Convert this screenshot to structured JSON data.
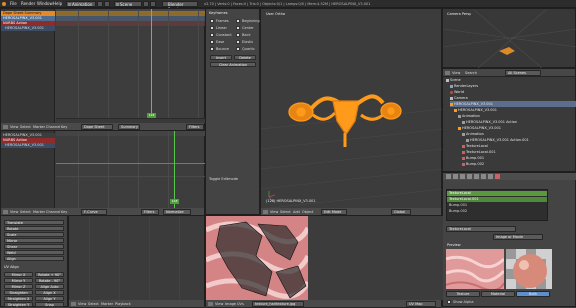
{
  "menu": {
    "items": [
      "File",
      "Render",
      "Window",
      "Help"
    ],
    "layout": "Animation",
    "scene": "Scene",
    "engine": "Blender Render",
    "info": "v2.70 | Verts:0 | Faces:0 | Tris:0 | Objects:0/1 | Lamps:0/0 | Mem:4.52M | HEROSALPINX_V3.001"
  },
  "dopesheet_top": {
    "rows": [
      "Dope Sheet Summary",
      "HEROSALPINX_V3.001",
      "NURBS Action",
      "HEROSALPINX_V3.001"
    ],
    "frame": "128",
    "ticks": [
      "0",
      "20",
      "40",
      "60",
      "80",
      "100",
      "120",
      "140",
      "160",
      "180",
      "200",
      "220",
      "240",
      "260",
      "280"
    ],
    "header": {
      "view": "View",
      "select": "Select",
      "marker": "Marker",
      "channel": "Channel",
      "key": "Key",
      "mode": "Dope Sheet",
      "summary": "Summary",
      "filters": "Filters"
    }
  },
  "dopesheet_mid": {
    "rows": [
      "HEROSALPINX_V3.001",
      "NURBS Action",
      "HEROSALPINX_V3.001"
    ],
    "frame": "128",
    "header": {
      "view": "View",
      "select": "Select",
      "marker": "Marker",
      "channel": "Channel",
      "key": "Key",
      "mode": "F-Curve",
      "filters": "Filters",
      "normalize": "Normalize"
    }
  },
  "tool_panel": {
    "title": "Keyframes",
    "labels": [
      "Frames",
      "Linear",
      "Constant",
      "Ease",
      "Bounce"
    ],
    "right_labels": [
      "Beginning",
      "Center",
      "Back",
      "Elastic",
      "Quartic"
    ],
    "insert": "Insert",
    "delete": "Delete",
    "clear": "Clear Animation",
    "toggle": "Toggle Editmode"
  },
  "viewport": {
    "label": "User Ortho",
    "object_label": "(128) HEROSALPINX_V3.001",
    "header": {
      "view": "View",
      "select": "Select",
      "add": "Add",
      "object": "Object",
      "mode": "Edit Mode",
      "global": "Global"
    }
  },
  "camera_view": {
    "label": "Camera Persp"
  },
  "outliner": {
    "search": "All Scenes",
    "tabs": [
      "View",
      "Search",
      "All Scenes"
    ],
    "rows": [
      "Scene",
      "RenderLayers",
      "World",
      "Camera",
      "HEROSALPINX_V3.001",
      "HEROSALPINX_V3.001",
      "Animation",
      "HEROSALPINX_V3.001 Action",
      "HEROSALPINX_V3.001",
      "Animation",
      "HEROSALPINX_V3.001 Action.001",
      "TextureLocal",
      "TextureLocal.001",
      "Bump.001",
      "Bump.002"
    ]
  },
  "properties": {
    "slots": [
      "TextureLocal",
      "TextureLocal.001",
      "Bump.001",
      "Bump.002"
    ],
    "tex_name": "TextureLocal",
    "type_label": "Image or Movie",
    "preview_label": "Preview",
    "tabs": [
      "Texture",
      "Material",
      "Both"
    ],
    "show_alpha": "Show Alpha"
  },
  "image_editor": {
    "header": {
      "view": "View",
      "image": "Image",
      "uvs": "UVs",
      "mode": "UV Map"
    },
    "image_name": "texture_hairtexture.jpg"
  },
  "bottom_left": {
    "rows": [
      "Translate",
      "Rotate",
      "Scale",
      "Mirror",
      "Shear",
      "Weld",
      "Align"
    ],
    "section": "UV Align",
    "props": [
      "Mirror X",
      "Mirror Y",
      "Mirror Z",
      "Straighten",
      "Straighten X",
      "Straighten Y"
    ],
    "props2": [
      "Rotate + 90°",
      "Rotate - 90°",
      "Align Auto",
      "Align X",
      "Align Y",
      "Snap"
    ]
  },
  "timeline": {
    "header": {
      "view": "View",
      "select": "Select",
      "marker": "Marker",
      "playback": "Playback"
    }
  },
  "colors": {
    "accent": "#f0a030",
    "select": "#5d8fcd",
    "green": "#4d9f3a",
    "orange_object": "#ff9a1a"
  }
}
